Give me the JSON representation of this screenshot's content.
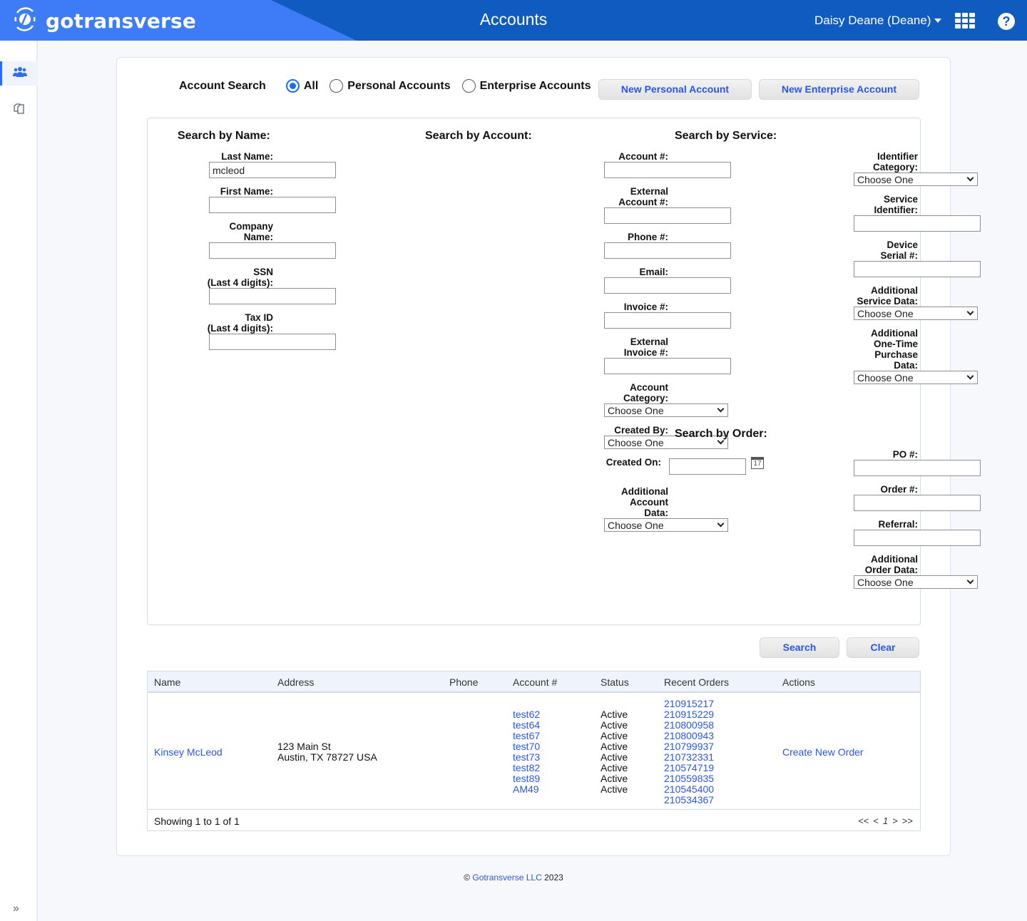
{
  "header": {
    "brand": "gotransverse",
    "title": "Accounts",
    "user": "Daisy Deane (Deane)",
    "icons": [
      "logo-icon",
      "apps-grid-icon",
      "help-icon"
    ],
    "help_glyph": "?"
  },
  "sidebar": {
    "items": [
      {
        "name": "accounts",
        "icon": "users-icon",
        "active": true
      },
      {
        "name": "catalog",
        "icon": "copy-icon",
        "active": false
      }
    ],
    "expand_glyph": "»"
  },
  "account_search": {
    "label": "Account Search",
    "options": [
      {
        "label": "All",
        "checked": true
      },
      {
        "label": "Personal Accounts",
        "checked": false
      },
      {
        "label": "Enterprise Accounts",
        "checked": false
      }
    ],
    "new_personal_label": "New Personal Account",
    "new_enterprise_label": "New Enterprise Account"
  },
  "search_by_name": {
    "title": "Search by Name:",
    "fields": [
      {
        "label": "Last Name:",
        "type": "text",
        "value": "mcleod"
      },
      {
        "label": "First Name:",
        "type": "text",
        "value": ""
      },
      {
        "label": "Company\nName:",
        "type": "text",
        "value": ""
      },
      {
        "label": "SSN\n(Last 4 digits):",
        "type": "text",
        "value": ""
      },
      {
        "label": "Tax ID\n(Last 4 digits):",
        "type": "text",
        "value": ""
      }
    ]
  },
  "search_by_account": {
    "title": "Search by Account:",
    "fields": [
      {
        "label": "Account #:",
        "type": "text",
        "value": ""
      },
      {
        "label": "External\nAccount #:",
        "type": "text",
        "value": ""
      },
      {
        "label": "Phone #:",
        "type": "text",
        "value": ""
      },
      {
        "label": "Email:",
        "type": "text",
        "value": ""
      },
      {
        "label": "Invoice #:",
        "type": "text",
        "value": ""
      },
      {
        "label": "External\nInvoice #:",
        "type": "text",
        "value": ""
      },
      {
        "label": "Account\nCategory:",
        "type": "select",
        "value": "Choose One"
      },
      {
        "label": "Created By:",
        "type": "select",
        "value": "Choose One"
      },
      {
        "label": "Created On:",
        "type": "date",
        "value": "",
        "icon": "calendar-icon",
        "icon_text": "17"
      },
      {
        "label": "Additional\nAccount\nData:",
        "type": "select",
        "value": "Choose One"
      }
    ]
  },
  "search_by_service": {
    "title": "Search by Service:",
    "fields": [
      {
        "label": "Identifier\nCategory:",
        "type": "select",
        "value": "Choose One"
      },
      {
        "label": "Service\nIdentifier:",
        "type": "text",
        "value": ""
      },
      {
        "label": "Device\nSerial #:",
        "type": "text",
        "value": ""
      },
      {
        "label": "Additional\nService Data:",
        "type": "select",
        "value": "Choose One"
      },
      {
        "label": "Additional\nOne-Time\nPurchase\nData:",
        "type": "select",
        "value": "Choose One"
      }
    ]
  },
  "search_by_order": {
    "title": "Search by Order:",
    "fields": [
      {
        "label": "PO #:",
        "type": "text",
        "value": ""
      },
      {
        "label": "Order #:",
        "type": "text",
        "value": ""
      },
      {
        "label": "Referral:",
        "type": "text",
        "value": ""
      },
      {
        "label": "Additional\nOrder Data:",
        "type": "select",
        "value": "Choose One"
      }
    ]
  },
  "actions": {
    "search_label": "Search",
    "clear_label": "Clear"
  },
  "results": {
    "columns": [
      "Name",
      "Address",
      "Phone",
      "Account #",
      "Status",
      "Recent Orders",
      "Actions"
    ],
    "rows": [
      {
        "name": "Kinsey McLeod",
        "address_line1": "123 Main St",
        "address_line2": "Austin, TX 78727 USA",
        "phone": "",
        "accounts": [
          {
            "number": "test62",
            "status": "Active"
          },
          {
            "number": "test64",
            "status": "Active"
          },
          {
            "number": "test67",
            "status": "Active"
          },
          {
            "number": "test70",
            "status": "Active"
          },
          {
            "number": "test73",
            "status": "Active"
          },
          {
            "number": "test82",
            "status": "Active"
          },
          {
            "number": "test89",
            "status": "Active"
          },
          {
            "number": "AM49",
            "status": "Active"
          }
        ],
        "recent_orders": [
          "210915217",
          "210915229",
          "210800958",
          "210800943",
          "210799937",
          "210732331",
          "210574719",
          "210559835",
          "210545400",
          "210534367"
        ],
        "action": "Create New Order"
      }
    ],
    "summary": "Showing 1 to 1 of 1",
    "pager": {
      "first": "<<",
      "prev": "<",
      "current": "1",
      "next": ">",
      "last": ">>"
    }
  },
  "footer": {
    "copyright": "©",
    "company": "Gotransverse LLC",
    "year": "2023"
  },
  "colors": {
    "header": "#0f5bbf",
    "brand_panel": "#3d7bf7",
    "link": "#2a56e8",
    "accent": "#1a6ef5"
  }
}
